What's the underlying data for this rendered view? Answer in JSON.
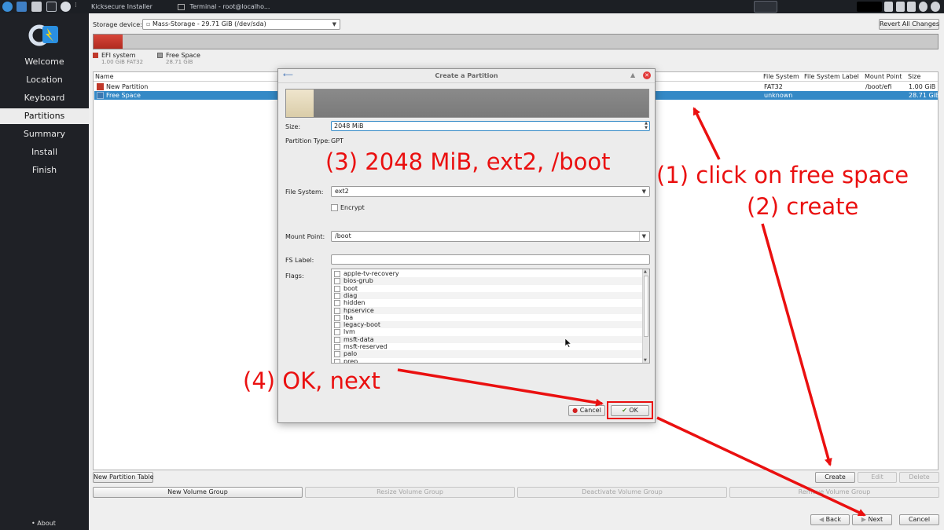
{
  "taskbar": {
    "tasks": [
      "Kicksecure Installer",
      "Terminal - root@localho..."
    ]
  },
  "sidebar": {
    "items": [
      "Welcome",
      "Location",
      "Keyboard",
      "Partitions",
      "Summary",
      "Install",
      "Finish"
    ],
    "active": "Partitions",
    "about": "About"
  },
  "main": {
    "storage_label": "Storage device:",
    "storage_value": "Mass-Storage - 29.71 GiB (/dev/sda)",
    "revert": "Revert All Changes",
    "legend": [
      {
        "name": "EFI system",
        "detail": "1.00 GiB  FAT32",
        "color": "#c0392b"
      },
      {
        "name": "Free Space",
        "detail": "28.71 GiB",
        "color": "#9a9a9a"
      }
    ],
    "table": {
      "headers": [
        "Name",
        "File System",
        "File System Label",
        "Mount Point",
        "Size"
      ],
      "rows": [
        {
          "name": "New Partition",
          "fs": "FAT32",
          "label": "",
          "mount": "/boot/efi",
          "size": "1.00 GiB",
          "color": "#c0392b"
        },
        {
          "name": "Free Space",
          "fs": "unknown",
          "label": "",
          "mount": "",
          "size": "28.71 GiB",
          "color": "#3c78b0"
        }
      ]
    },
    "buttons": {
      "new_table": "New Partition Table",
      "create": "Create",
      "edit": "Edit",
      "delete": "Delete",
      "new_vg": "New Volume Group",
      "resize_vg": "Resize Volume Group",
      "deactivate_vg": "Deactivate Volume Group",
      "remove_vg": "Remove Volume Group",
      "back": "Back",
      "next": "Next",
      "cancel": "Cancel"
    }
  },
  "dialog": {
    "title": "Create a Partition",
    "size_label": "Size:",
    "size_value": "2048 MiB",
    "ptype_label": "Partition Type:",
    "ptype_value": "GPT",
    "fs_label": "File System:",
    "fs_value": "ext2",
    "encrypt": "Encrypt",
    "mount_label": "Mount Point:",
    "mount_value": "/boot",
    "fslabel_label": "FS Label:",
    "flags_label": "Flags:",
    "flags": [
      "apple-tv-recovery",
      "bios-grub",
      "boot",
      "diag",
      "hidden",
      "hpservice",
      "lba",
      "legacy-boot",
      "lvm",
      "msft-data",
      "msft-reserved",
      "palo",
      "prep"
    ],
    "cancel": "Cancel",
    "ok": "OK"
  },
  "annotations": {
    "step1": "(1) click on free space",
    "step2": "(2) create",
    "step3": "(3) 2048 MiB, ext2, /boot",
    "step4": "(4) OK, next",
    "color": "#ea1010"
  }
}
